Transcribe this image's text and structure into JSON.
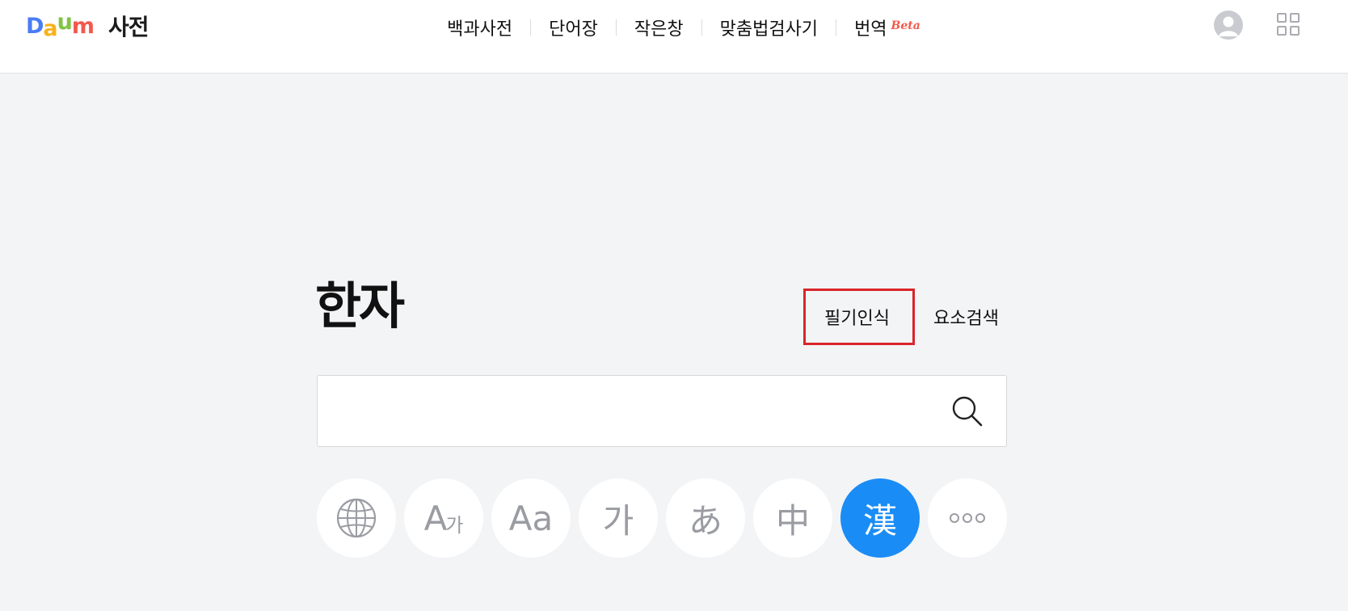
{
  "brand": {
    "logo_letters": [
      "D",
      "a",
      "u",
      "m"
    ],
    "logo_colors": [
      "#4a7cf4",
      "#f6b21b",
      "#7fc443",
      "#f2584b"
    ],
    "service_name": "사전"
  },
  "nav": {
    "items": [
      {
        "label": "백과사전"
      },
      {
        "label": "단어장"
      },
      {
        "label": "작은창"
      },
      {
        "label": "맞춤법검사기"
      },
      {
        "label": "번역",
        "badge": "Beta"
      }
    ]
  },
  "header_icons": {
    "avatar": "user-avatar-icon",
    "apps": "apps-grid-icon"
  },
  "main": {
    "title": "한자",
    "tools": {
      "handwriting": "필기인식",
      "component_search": "요소검색"
    },
    "highlight_color": "#d9252a"
  },
  "search": {
    "value": "",
    "placeholder": "",
    "icon": "search-icon"
  },
  "dictionaries": [
    {
      "icon": "globe-icon",
      "active": false
    },
    {
      "label": "A",
      "sub": "가",
      "active": false
    },
    {
      "label": "Aa",
      "active": false
    },
    {
      "label": "가",
      "active": false
    },
    {
      "label": "あ",
      "active": false
    },
    {
      "label": "中",
      "active": false
    },
    {
      "label": "漢",
      "active": true
    },
    {
      "icon": "more-icon",
      "active": false
    }
  ],
  "colors": {
    "accent": "#1a8cf5",
    "background": "#f3f4f6"
  }
}
